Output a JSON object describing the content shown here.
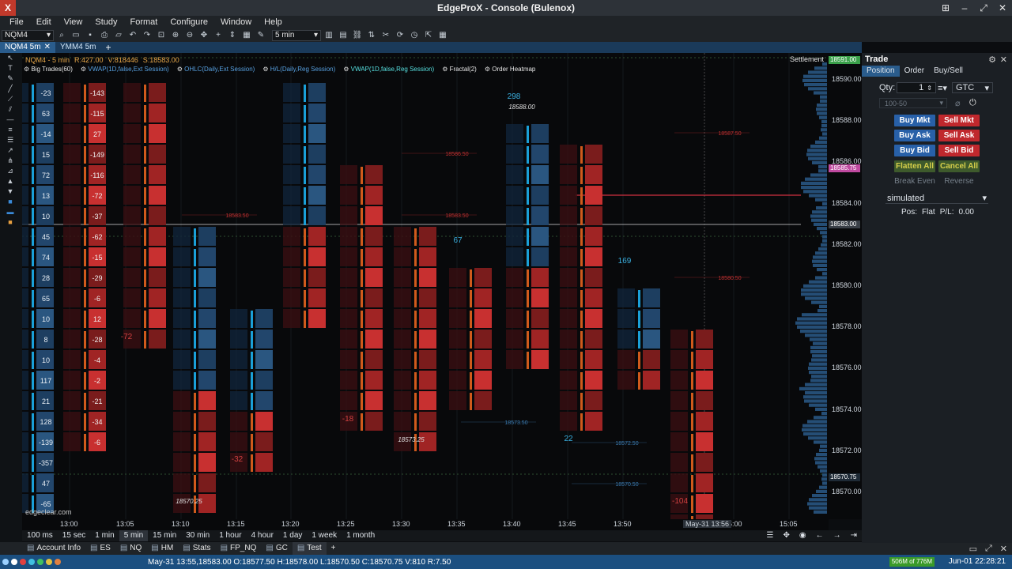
{
  "window": {
    "title": "EdgeProX - Console (Bulenox)"
  },
  "menu": [
    "File",
    "Edit",
    "View",
    "Study",
    "Format",
    "Configure",
    "Window",
    "Help"
  ],
  "toolbar": {
    "symbol": "NQM4",
    "interval": "5 min"
  },
  "chart_tabs": [
    {
      "label": "NQM4 5m",
      "active": true
    },
    {
      "label": "YMM4 5m",
      "active": false
    }
  ],
  "chart": {
    "header": {
      "symbol_tf": "NQM4 - 5 min",
      "range": "R:427.00",
      "vol": "V:818446",
      "spread": "S:18583.00"
    },
    "indicators": [
      {
        "label": "Big Trades(60)",
        "color": "#e8e8e8"
      },
      {
        "label": "VWAP(1D,false,Ext Session)",
        "color": "#57a0e0"
      },
      {
        "label": "OHLC(Daily,Ext Session)",
        "color": "#57a0e0"
      },
      {
        "label": "H/L(Daily,Reg Session)",
        "color": "#57a0e0"
      },
      {
        "label": "VWAP(1D,false,Reg Session)",
        "color": "#57e0e0"
      },
      {
        "label": "Fractal(2)",
        "color": "#e8e8e8"
      },
      {
        "label": "Order Heatmap",
        "color": "#e8e8e8"
      }
    ],
    "settlement_label": "Settlement",
    "watermark": "edgeclear.com",
    "price_ticks": [
      "18590.00",
      "18588.00",
      "18586.00",
      "18584.00",
      "18582.00",
      "18580.00",
      "18578.00",
      "18576.00",
      "18574.00",
      "18572.00",
      "18570.00"
    ],
    "price_badges": [
      {
        "text": "18591.00",
        "color": "#3aa04a"
      },
      {
        "text": "18585.75",
        "color": "#c04aa0"
      },
      {
        "text": "18583.00",
        "color": "#3a4048"
      },
      {
        "text": "18570.75",
        "color": "#1e2a36"
      }
    ],
    "time_ticks": [
      "13:00",
      "13:05",
      "13:10",
      "13:15",
      "13:20",
      "13:25",
      "13:30",
      "13:35",
      "13:40",
      "13:45",
      "13:50",
      "15:00",
      "15:05"
    ],
    "crosshair_label": "May-31 13:56",
    "bar_annotations": [
      "298",
      "67",
      "169",
      "22",
      "-72",
      "-18",
      "-32",
      "-104"
    ],
    "swing_labels": [
      "18588.00",
      "18573.25",
      "18570.25"
    ],
    "level_labels": [
      "18587.50",
      "18586.50",
      "18583.50",
      "18583.50",
      "18580.50",
      "18573.50",
      "18572.50",
      "18570.50"
    ],
    "footprint_values": {
      "col1": [
        "-23",
        "63",
        "-14",
        "15",
        "72",
        "13",
        "10",
        "45",
        "74",
        "28",
        "65",
        "10",
        "8",
        "10",
        "117",
        "21",
        "128",
        "-139",
        "-357",
        "47",
        "-65"
      ],
      "col2": [
        "-143",
        "-115",
        "27",
        "-149",
        "-116",
        "-72",
        "-37",
        "-62",
        "-15",
        "-29",
        "-6",
        "12",
        "-28",
        "-4",
        "-2",
        "-21",
        "-34",
        "-6"
      ]
    }
  },
  "timeframes": [
    "100 ms",
    "15 sec",
    "1 min",
    "5 min",
    "15 min",
    "30 min",
    "1 hour",
    "4 hour",
    "1 day",
    "1 week",
    "1 month"
  ],
  "active_timeframe": "5 min",
  "bottom_tabs": [
    "Account Info",
    "ES",
    "NQ",
    "HM",
    "Stats",
    "FP_NQ",
    "GC",
    "Test"
  ],
  "active_bottom_tab": "Test",
  "status": {
    "ohlc": "May-31 13:55,18583.00 O:18577.50 H:18578.00 L:18570.50 C:18570.75 V:810 R:7.50",
    "memory": "506M of 776M",
    "datetime": "Jun-01 22:28:21"
  },
  "trade": {
    "title": "Trade",
    "tabs": [
      "Position",
      "Order",
      "Buy/Sell"
    ],
    "qty_label": "Qty:",
    "qty_value": "1",
    "tif": "GTC",
    "bracket": "100-50",
    "buttons": {
      "buy_mkt": "Buy Mkt",
      "sell_mkt": "Sell Mkt",
      "buy_ask": "Buy Ask",
      "sell_ask": "Sell Ask",
      "buy_bid": "Buy Bid",
      "sell_bid": "Sell Bid",
      "flatten_all": "Flatten All",
      "cancel_all": "Cancel All",
      "break_even": "Break Even",
      "reverse": "Reverse"
    },
    "account": "simulated",
    "pos_label": "Pos:",
    "pos_value": "Flat",
    "pl_label": "P/L:",
    "pl_value": "0.00"
  }
}
